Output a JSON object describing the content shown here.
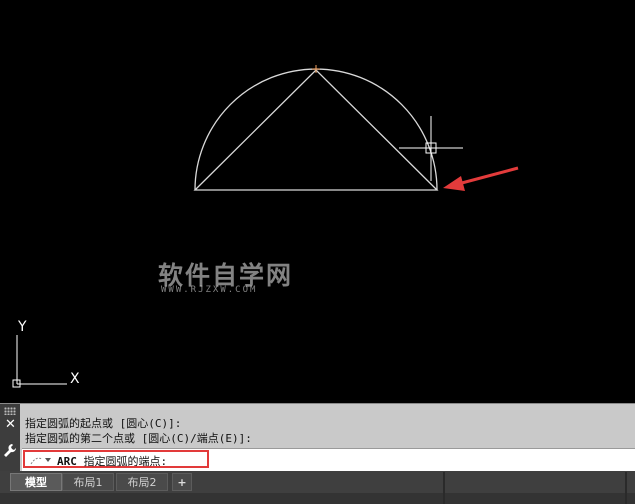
{
  "watermark": {
    "title": "软件自学网",
    "url": "WWW.RJZXW.COM"
  },
  "ucs": {
    "y_label": "Y",
    "x_label": "X"
  },
  "command_window": {
    "history": [
      "指定圆弧的起点或 [圆心(C)]:",
      "指定圆弧的第二个点或 [圆心(C)/端点(E)]:"
    ],
    "close_glyph": "✕",
    "prompt_command": "ARC",
    "prompt_text": " 指定圆弧的端点:",
    "highlight_color": "#e23a3a"
  },
  "tabs": [
    {
      "label": "模型",
      "active": true
    },
    {
      "label": "布局1",
      "active": false
    },
    {
      "label": "布局2",
      "active": false
    },
    {
      "label": "+",
      "active": false
    }
  ],
  "colors": {
    "canvas": "#000000",
    "geometry": "#d9d9d9",
    "grip": "#f0a060",
    "arrow": "#e33b3b"
  }
}
